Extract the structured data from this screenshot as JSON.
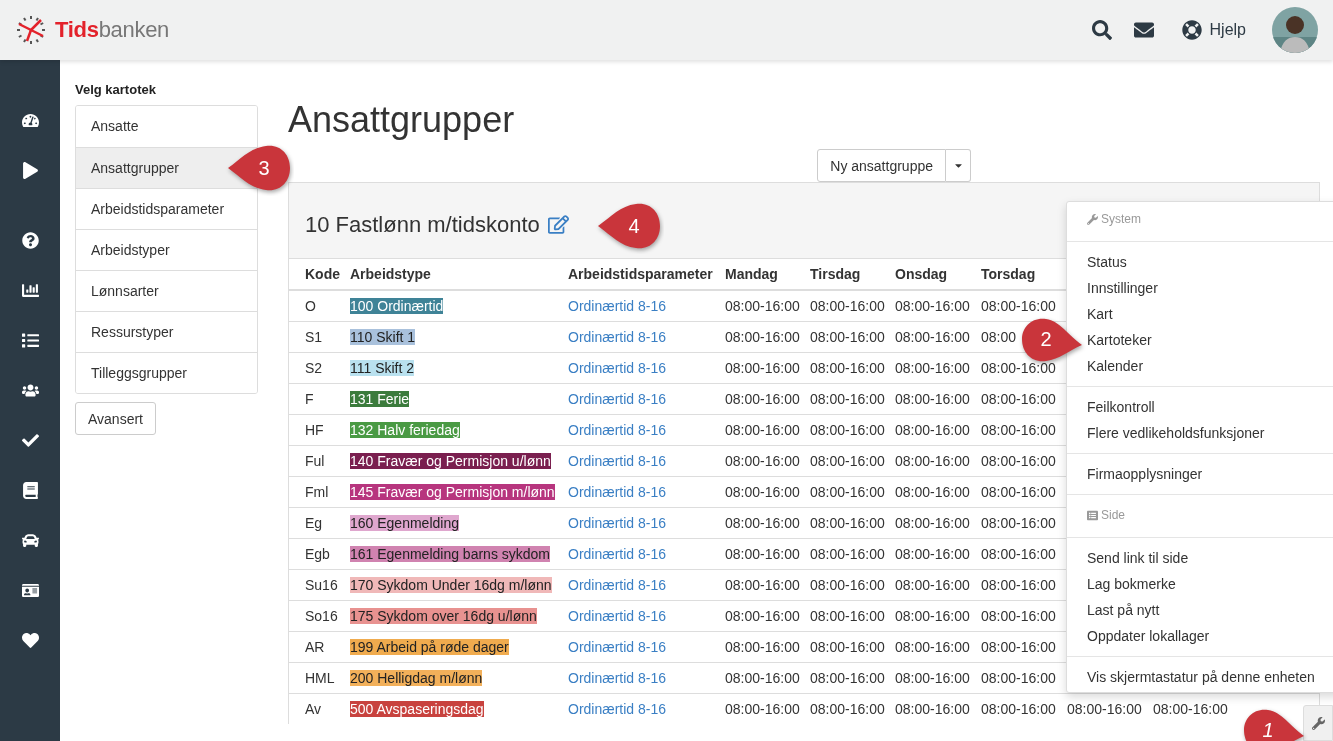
{
  "brand": {
    "accent": "Tids",
    "rest": "banken"
  },
  "header": {
    "help": "Hjelp"
  },
  "kartotek": {
    "title": "Velg kartotek",
    "items": [
      {
        "label": "Ansatte",
        "selected": false
      },
      {
        "label": "Ansattgrupper",
        "selected": true
      },
      {
        "label": "Arbeidstidsparameter",
        "selected": false
      },
      {
        "label": "Arbeidstyper",
        "selected": false
      },
      {
        "label": "Lønnsarter",
        "selected": false
      },
      {
        "label": "Ressurstyper",
        "selected": false
      },
      {
        "label": "Tilleggsgrupper",
        "selected": false
      }
    ],
    "advanced": "Avansert"
  },
  "page_title": "Ansattgrupper",
  "new_button": "Ny ansattgruppe",
  "panel_title": "10 Fastlønn m/tidskonto",
  "table": {
    "columns": [
      "Kode",
      "Arbeidstype",
      "Arbeidstidsparameter",
      "Mandag",
      "Tirsdag",
      "Onsdag",
      "Torsdag"
    ],
    "rows": [
      {
        "code": "O",
        "type": "100 Ordinærtid",
        "color": "#3f8397",
        "param": "Ordinærtid 8-16",
        "times": [
          "08:00-16:00",
          "08:00-16:00",
          "08:00-16:00",
          "08:00-16:00"
        ]
      },
      {
        "code": "S1",
        "type": "110 Skift 1",
        "color": "#a9c1dc",
        "param": "Ordinærtid 8-16",
        "times": [
          "08:00-16:00",
          "08:00-16:00",
          "08:00-16:00",
          "08:00"
        ]
      },
      {
        "code": "S2",
        "type": "111 Skift 2",
        "color": "#b9e1ef",
        "param": "Ordinærtid 8-16",
        "times": [
          "08:00-16:00",
          "08:00-16:00",
          "08:00-16:00",
          "08:00-16:00"
        ]
      },
      {
        "code": "F",
        "type": "131 Ferie",
        "color": "#3b7b3c",
        "param": "Ordinærtid 8-16",
        "times": [
          "08:00-16:00",
          "08:00-16:00",
          "08:00-16:00",
          "08:00-16:00"
        ]
      },
      {
        "code": "HF",
        "type": "132 Halv feriedag",
        "color": "#4a9a44",
        "param": "Ordinærtid 8-16",
        "times": [
          "08:00-16:00",
          "08:00-16:00",
          "08:00-16:00",
          "08:00-16:00"
        ]
      },
      {
        "code": "Ful",
        "type": "140 Fravær og Permisjon u/lønn",
        "color": "#7a1f4f",
        "param": "Ordinærtid 8-16",
        "times": [
          "08:00-16:00",
          "08:00-16:00",
          "08:00-16:00",
          "08:00-16:00"
        ]
      },
      {
        "code": "Fml",
        "type": "145 Fravær og Permisjon m/lønn",
        "color": "#b7357e",
        "param": "Ordinærtid 8-16",
        "times": [
          "08:00-16:00",
          "08:00-16:00",
          "08:00-16:00",
          "08:00-16:00"
        ]
      },
      {
        "code": "Eg",
        "type": "160 Egenmelding",
        "color": "#dfa7ce",
        "param": "Ordinærtid 8-16",
        "times": [
          "08:00-16:00",
          "08:00-16:00",
          "08:00-16:00",
          "08:00-16:00"
        ]
      },
      {
        "code": "Egb",
        "type": "161 Egenmelding barns sykdom",
        "color": "#d083b0",
        "param": "Ordinærtid 8-16",
        "times": [
          "08:00-16:00",
          "08:00-16:00",
          "08:00-16:00",
          "08:00-16:00"
        ]
      },
      {
        "code": "Su16",
        "type": "170 Sykdom Under 16dg m/lønn",
        "color": "#f0b8b8",
        "param": "Ordinærtid 8-16",
        "times": [
          "08:00-16:00",
          "08:00-16:00",
          "08:00-16:00",
          "08:00-16:00"
        ]
      },
      {
        "code": "So16",
        "type": "175 Sykdom over 16dg u/lønn",
        "color": "#e89290",
        "param": "Ordinærtid 8-16",
        "times": [
          "08:00-16:00",
          "08:00-16:00",
          "08:00-16:00",
          "08:00-16:00"
        ]
      },
      {
        "code": "AR",
        "type": "199 Arbeid på røde dager",
        "color": "#f0ab4e",
        "param": "Ordinærtid 8-16",
        "times": [
          "08:00-16:00",
          "08:00-16:00",
          "08:00-16:00",
          "08:00-16:00"
        ]
      },
      {
        "code": "HML",
        "type": "200 Helligdag m/lønn",
        "color": "#f2b05a",
        "param": "Ordinærtid 8-16",
        "times": [
          "08:00-16:00",
          "08:00-16:00",
          "08:00-16:00",
          "08:00-16:00"
        ]
      },
      {
        "code": "Av",
        "type": "500 Avspaseringsdag",
        "color": "#c8423e",
        "param": "Ordinærtid 8-16",
        "times": [
          "08:00-16:00",
          "08:00-16:00",
          "08:00-16:00",
          "08:00-16:00",
          "08:00-16:00",
          "08:00-16:00"
        ]
      }
    ]
  },
  "system_menu": [
    {
      "kind": "header",
      "label": "System"
    },
    {
      "kind": "divider"
    },
    {
      "kind": "item",
      "label": "Status"
    },
    {
      "kind": "item",
      "label": "Innstillinger"
    },
    {
      "kind": "item",
      "label": "Kart"
    },
    {
      "kind": "item",
      "label": "Kartoteker"
    },
    {
      "kind": "item",
      "label": "Kalender"
    },
    {
      "kind": "divider"
    },
    {
      "kind": "item",
      "label": "Feilkontroll"
    },
    {
      "kind": "item",
      "label": "Flere vedlikeholdsfunksjoner"
    },
    {
      "kind": "divider"
    },
    {
      "kind": "item",
      "label": "Firmaopplysninger"
    },
    {
      "kind": "divider"
    },
    {
      "kind": "header",
      "label": "Side"
    },
    {
      "kind": "divider"
    },
    {
      "kind": "item",
      "label": "Send link til side"
    },
    {
      "kind": "item",
      "label": "Lag bokmerke"
    },
    {
      "kind": "item",
      "label": "Last på nytt"
    },
    {
      "kind": "item",
      "label": "Oppdater lokallager"
    },
    {
      "kind": "divider"
    },
    {
      "kind": "item",
      "label": "Vis skjermtastatur på denne enheten"
    }
  ],
  "callouts": [
    {
      "number": "1"
    },
    {
      "number": "2"
    },
    {
      "number": "3"
    },
    {
      "number": "4"
    }
  ]
}
